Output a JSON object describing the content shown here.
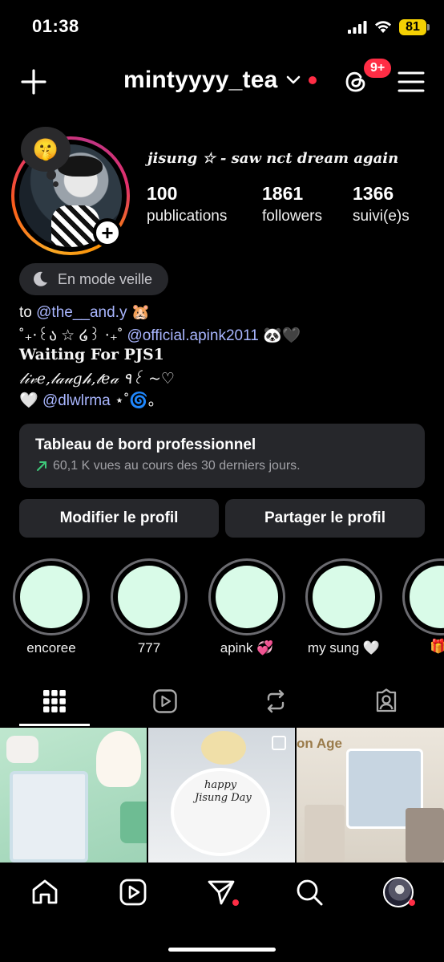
{
  "status_bar": {
    "time": "01:38",
    "battery": "81"
  },
  "header": {
    "username": "mintyyyy_tea",
    "threads_badge": "9+"
  },
  "profile": {
    "note": "jisung ☆ - saw nct dream again",
    "note_emoji": "🤫",
    "stats": [
      {
        "value": "100",
        "label": "publications"
      },
      {
        "value": "1861",
        "label": "followers"
      },
      {
        "value": "1366",
        "label": "suivi(e)s"
      }
    ],
    "sleep_mode": "En mode veille"
  },
  "bio": {
    "line1_prefix": "to ",
    "line1_mention": "@the__and.y",
    "line1_emoji": "🐹",
    "line2_prefix": "˚₊‧꒰ა ☆ ໒꒱ ‧₊˚ ",
    "line2_mention": "@official.apink2011",
    "line2_emoji": "🐼🖤",
    "line3": "Waiting For PJS1",
    "line4": "𝓁𝒾𝓋𝑒,𝓁𝒶𝓊𝑔𝒽,𝓉𝑒𝒶 ٩꒰ ~♡",
    "line5_prefix": "🤍 ",
    "line5_mention": "@dlwlrma",
    "line5_suffix": " ⋆˚🌀｡"
  },
  "dashboard": {
    "title": "Tableau de bord professionnel",
    "subtitle": "60,1 K vues au cours des 30 derniers jours."
  },
  "buttons": {
    "edit": "Modifier le profil",
    "share": "Partager le profil"
  },
  "highlights": [
    {
      "label": "encoree"
    },
    {
      "label": "777"
    },
    {
      "label": "apink 💞"
    },
    {
      "label": "my sung 🤍"
    },
    {
      "label": "🎁"
    }
  ],
  "grid": {
    "post2_text_line1": "happy",
    "post2_text_line2": "Jisung Day",
    "post3_text": "on Age"
  },
  "colors": {
    "accent_mention": "#a9b6ff",
    "badge_red": "#ff2d45",
    "highlight_fill": "#d9fbe8",
    "surface": "#26272b"
  }
}
